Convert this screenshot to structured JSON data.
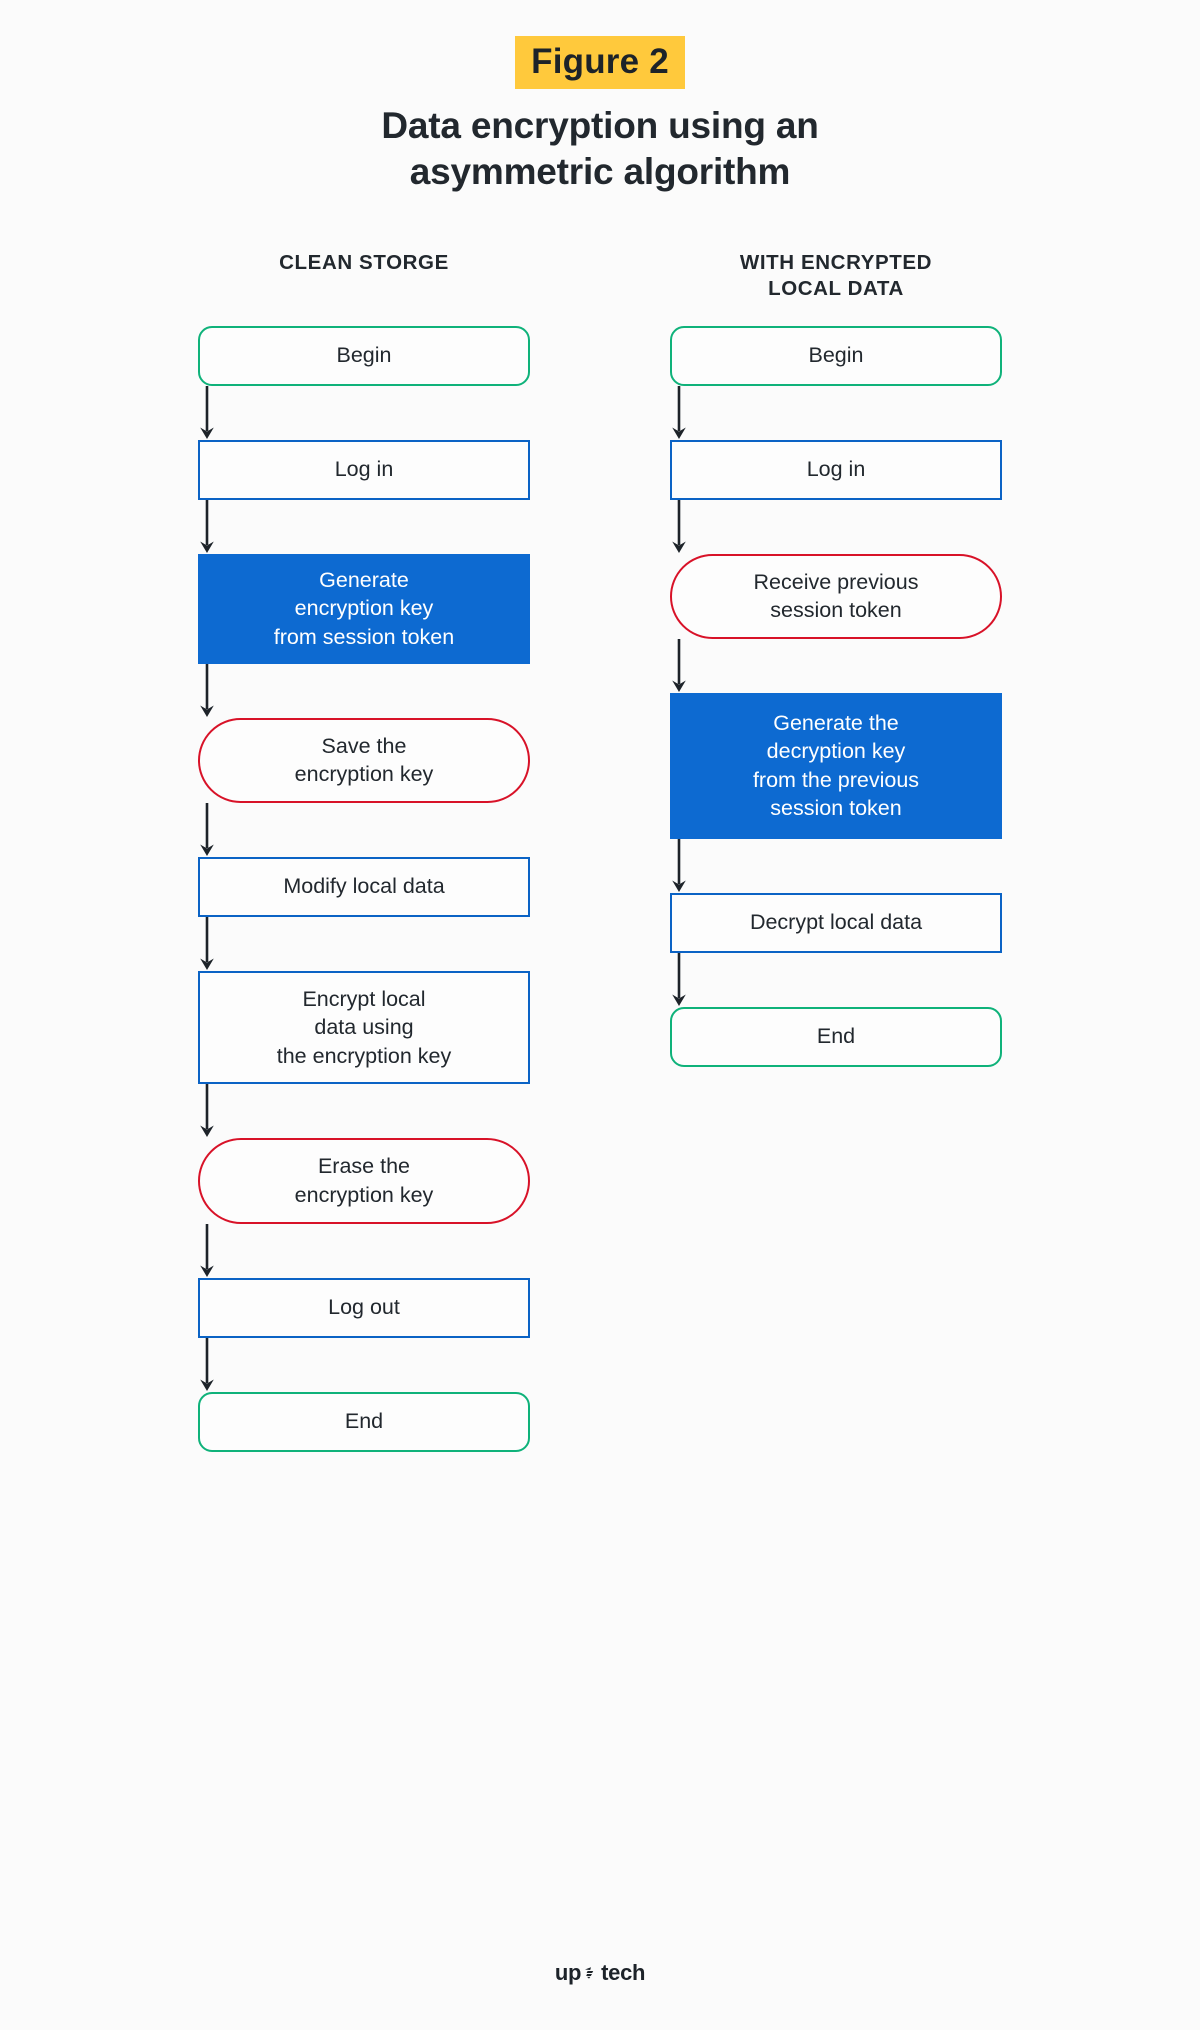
{
  "figure": {
    "badge": "Figure 2",
    "title_line1": "Data encryption using an",
    "title_line2": "asymmetric algorithm"
  },
  "colors": {
    "badge_bg": "#ffc93c",
    "terminal_border": "#0fb27a",
    "process_border": "#0b63c5",
    "key_border": "#d81228",
    "emphasis_fill": "#0d6ad1",
    "text": "#22282e",
    "page_bg": "#fbfbfb"
  },
  "columns": [
    {
      "header": "CLEAN STORGE",
      "nodes": [
        {
          "label": "Begin",
          "kind": "terminal"
        },
        {
          "label": "Log in",
          "kind": "process"
        },
        {
          "label": "Generate\nencryption key\nfrom session token",
          "kind": "emphasis"
        },
        {
          "label": "Save the\nencryption key",
          "kind": "key"
        },
        {
          "label": "Modify local data",
          "kind": "process"
        },
        {
          "label": "Encrypt local\ndata using\nthe encryption key",
          "kind": "process"
        },
        {
          "label": "Erase the\nencryption key",
          "kind": "key"
        },
        {
          "label": "Log out",
          "kind": "process"
        },
        {
          "label": "End",
          "kind": "terminal"
        }
      ]
    },
    {
      "header": "WITH ENCRYPTED\nLOCAL DATA",
      "nodes": [
        {
          "label": "Begin",
          "kind": "terminal"
        },
        {
          "label": "Log in",
          "kind": "process"
        },
        {
          "label": "Receive previous\nsession token",
          "kind": "key"
        },
        {
          "label": "Generate the\ndecryption key\nfrom the previous\nsession token",
          "kind": "emphasis"
        },
        {
          "label": "Decrypt local data",
          "kind": "process"
        },
        {
          "label": "End",
          "kind": "terminal"
        }
      ]
    }
  ],
  "footer": {
    "logo_left": "up",
    "logo_right": "tech",
    "logo_mark": "bee-icon"
  }
}
